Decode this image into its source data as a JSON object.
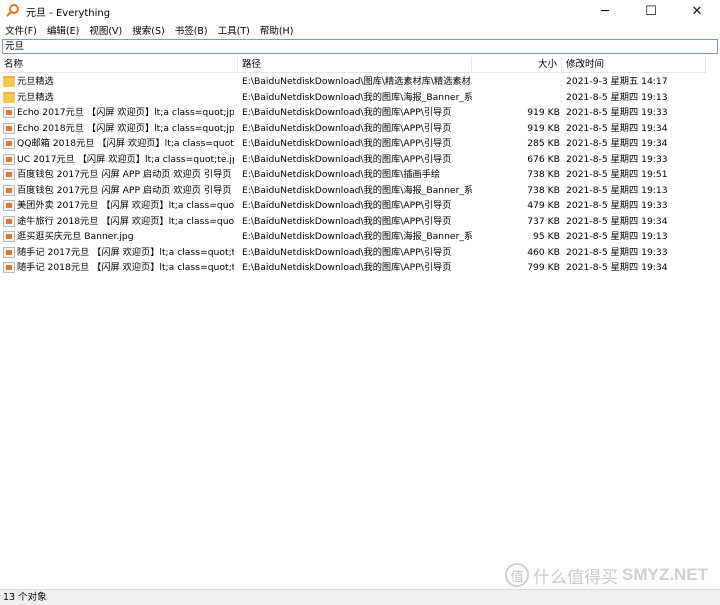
{
  "window": {
    "title": "元旦 - Everything",
    "minimize": "─",
    "maximize": "☐",
    "close": "✕"
  },
  "menu": [
    "文件(F)",
    "编辑(E)",
    "视图(V)",
    "搜索(S)",
    "书签(B)",
    "工具(T)",
    "帮助(H)"
  ],
  "search": {
    "value": "元旦"
  },
  "columns": {
    "name": "名称",
    "path": "路径",
    "size": "大小",
    "date": "修改时间"
  },
  "rows": [
    {
      "icon": "folder-icon",
      "name": "元旦精选",
      "path": "E:\\BaiduNetdiskDownload\\图库\\精选素材库\\精选素材...",
      "size": "",
      "date": "2021-9-3 星期五 14:17"
    },
    {
      "icon": "folder-icon",
      "name": "元旦精选",
      "path": "E:\\BaiduNetdiskDownload\\我的图库\\海报_Banner_系",
      "size": "",
      "date": "2021-8-5 星期四 19:13"
    },
    {
      "icon": "image-file-icon",
      "name": "Echo 2017元旦 【闪屏 欢迎页】lt;a class=quot;jpg",
      "path": "E:\\BaiduNetdiskDownload\\我的图库\\APP\\引导页",
      "size": "919 KB",
      "date": "2021-8-5 星期四 19:33"
    },
    {
      "icon": "image-file-icon",
      "name": "Echo 2018元旦 【闪屏 欢迎页】lt;a class=quot;jpg",
      "path": "E:\\BaiduNetdiskDownload\\我的图库\\APP\\引导页",
      "size": "919 KB",
      "date": "2021-8-5 星期四 19:34"
    },
    {
      "icon": "image-file-icon",
      "name": "QQ邮箱 2018元旦 【闪屏 欢迎页】lt;a class=quot;j...",
      "path": "E:\\BaiduNetdiskDownload\\我的图库\\APP\\引导页",
      "size": "285 KB",
      "date": "2021-8-5 星期四 19:34"
    },
    {
      "icon": "image-file-icon",
      "name": "UC 2017元旦 【闪屏 欢迎页】lt;a class=quot;te.jpg",
      "path": "E:\\BaiduNetdiskDownload\\我的图库\\APP\\引导页",
      "size": "676 KB",
      "date": "2021-8-5 星期四 19:33"
    },
    {
      "icon": "image-file-icon",
      "name": "百度钱包 2017元旦 闪屏 APP 启动页 欢迎页 引导页 ...",
      "path": "E:\\BaiduNetdiskDownload\\我的图库\\插画手绘",
      "size": "738 KB",
      "date": "2021-8-5 星期四 19:51"
    },
    {
      "icon": "image-file-icon",
      "name": "百度钱包 2017元旦 闪屏 APP 启动页 欢迎页 引导页 ...",
      "path": "E:\\BaiduNetdiskDownload\\我的图库\\海报_Banner_系...",
      "size": "738 KB",
      "date": "2021-8-5 星期四 19:13"
    },
    {
      "icon": "image-file-icon",
      "name": "美团外卖 2017元旦 【闪屏 欢迎页】lt;a class=quot;...",
      "path": "E:\\BaiduNetdiskDownload\\我的图库\\APP\\引导页",
      "size": "479 KB",
      "date": "2021-8-5 星期四 19:33"
    },
    {
      "icon": "image-file-icon",
      "name": "途牛旅行 2018元旦 【闪屏 欢迎页】lt;a class=quot;...",
      "path": "E:\\BaiduNetdiskDownload\\我的图库\\APP\\引导页",
      "size": "737 KB",
      "date": "2021-8-5 星期四 19:34"
    },
    {
      "icon": "image-file-icon",
      "name": "逛买逛买庆元旦 Banner.jpg",
      "path": "E:\\BaiduNetdiskDownload\\我的图库\\海报_Banner_系...",
      "size": "95 KB",
      "date": "2021-8-5 星期四 19:13"
    },
    {
      "icon": "image-file-icon",
      "name": "随手记 2017元旦 【闪屏 欢迎页】lt;a class=quot;t.j...",
      "path": "E:\\BaiduNetdiskDownload\\我的图库\\APP\\引导页",
      "size": "460 KB",
      "date": "2021-8-5 星期四 19:33"
    },
    {
      "icon": "image-file-icon",
      "name": "随手记 2018元旦 【闪屏 欢迎页】lt;a class=quot;t.j...",
      "path": "E:\\BaiduNetdiskDownload\\我的图库\\APP\\引导页",
      "size": "799 KB",
      "date": "2021-8-5 星期四 19:34"
    }
  ],
  "status": "13 个对象",
  "watermark": {
    "badge": "值",
    "cn": "什么值得买",
    "en": "SMYZ.NET"
  }
}
